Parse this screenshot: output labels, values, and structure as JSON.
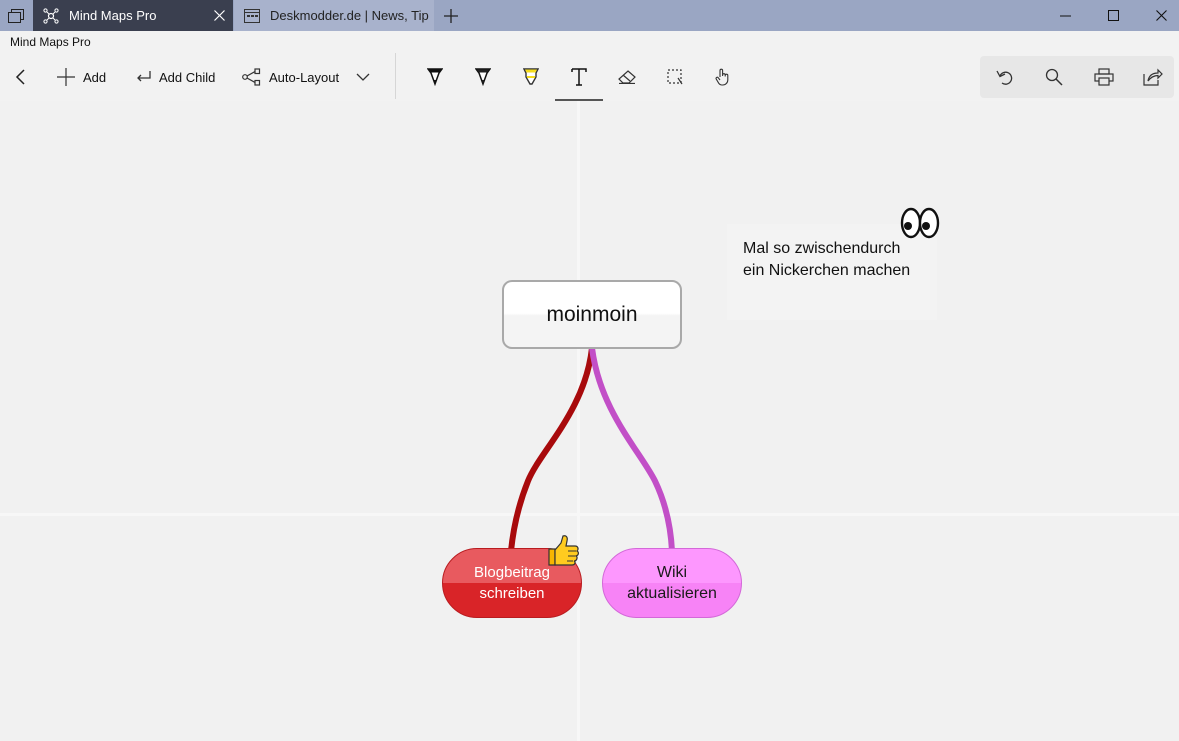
{
  "window": {
    "tabs": [
      {
        "title": "Mind Maps Pro",
        "active": true
      },
      {
        "title": "Deskmodder.de | News, Tip",
        "active": false
      }
    ],
    "new_tab_icon": "plus-icon",
    "controls": [
      "minimize-icon",
      "maximize-icon",
      "close-icon"
    ]
  },
  "app": {
    "title": "Mind Maps Pro"
  },
  "toolbar": {
    "back_icon": "back-arrow-icon",
    "add_label": "Add",
    "add_child_label": "Add Child",
    "auto_layout_label": "Auto-Layout",
    "tools": [
      "pen-black-icon",
      "pen-dark-icon",
      "highlighter-yellow-icon",
      "text-tool-icon",
      "eraser-icon",
      "lasso-select-icon",
      "touch-hand-icon"
    ],
    "selected_tool": "text-tool-icon",
    "actions": [
      "undo-icon",
      "search-icon",
      "print-icon",
      "share-icon"
    ]
  },
  "mindmap": {
    "root": {
      "label": "moinmoin"
    },
    "children": [
      {
        "label": "Blogbeitrag\nschreiben",
        "color": "#d92428",
        "line_color": "#a80a0c",
        "sticker": "thumbs-up-icon"
      },
      {
        "label": "Wiki\naktualisieren",
        "color": "#f783f6",
        "line_color": "#c24fc7"
      }
    ],
    "note": {
      "text": "Mal so zwischendurch\nein Nickerchen machen",
      "sticker": "eyes-icon"
    }
  },
  "colors": {
    "tabbar": "#9aa6c3",
    "active_tab": "#3a3f4f",
    "canvas": "#f1f1f1"
  }
}
